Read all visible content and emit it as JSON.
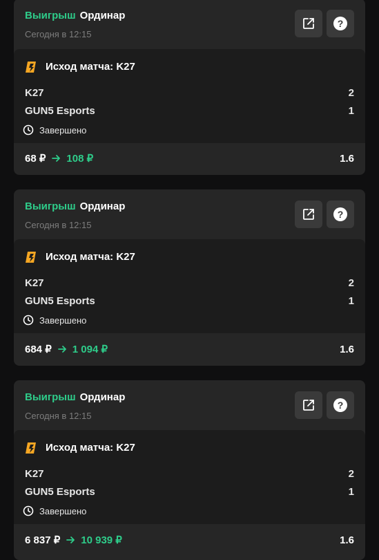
{
  "bets": [
    {
      "status": "Выигрыш",
      "type": "Ординар",
      "date": "Сегодня в 12:15",
      "market": "Исход матча: K27",
      "team1": {
        "name": "K27",
        "score": "2"
      },
      "team2": {
        "name": "GUN5 Esports",
        "score": "1"
      },
      "state": "Завершено",
      "stake": "68 ₽",
      "payout": "108 ₽",
      "odds": "1.6"
    },
    {
      "status": "Выигрыш",
      "type": "Ординар",
      "date": "Сегодня в 12:15",
      "market": "Исход матча: K27",
      "team1": {
        "name": "K27",
        "score": "2"
      },
      "team2": {
        "name": "GUN5 Esports",
        "score": "1"
      },
      "state": "Завершено",
      "stake": "684 ₽",
      "payout": "1 094 ₽",
      "odds": "1.6"
    },
    {
      "status": "Выигрыш",
      "type": "Ординар",
      "date": "Сегодня в 12:15",
      "market": "Исход матча: K27",
      "team1": {
        "name": "K27",
        "score": "2"
      },
      "team2": {
        "name": "GUN5 Esports",
        "score": "1"
      },
      "state": "Завершено",
      "stake": "6 837 ₽",
      "payout": "10 939 ₽",
      "odds": "1.6"
    }
  ],
  "icons": {
    "share": "external-link-icon",
    "help": "question-icon",
    "sport": "esports-icon",
    "clock": "clock-icon"
  },
  "colors": {
    "accent_green": "#2ecc8a",
    "card_bg": "#262626",
    "inner_bg": "#1c1c1c",
    "sport_icon": "#f5a623"
  }
}
